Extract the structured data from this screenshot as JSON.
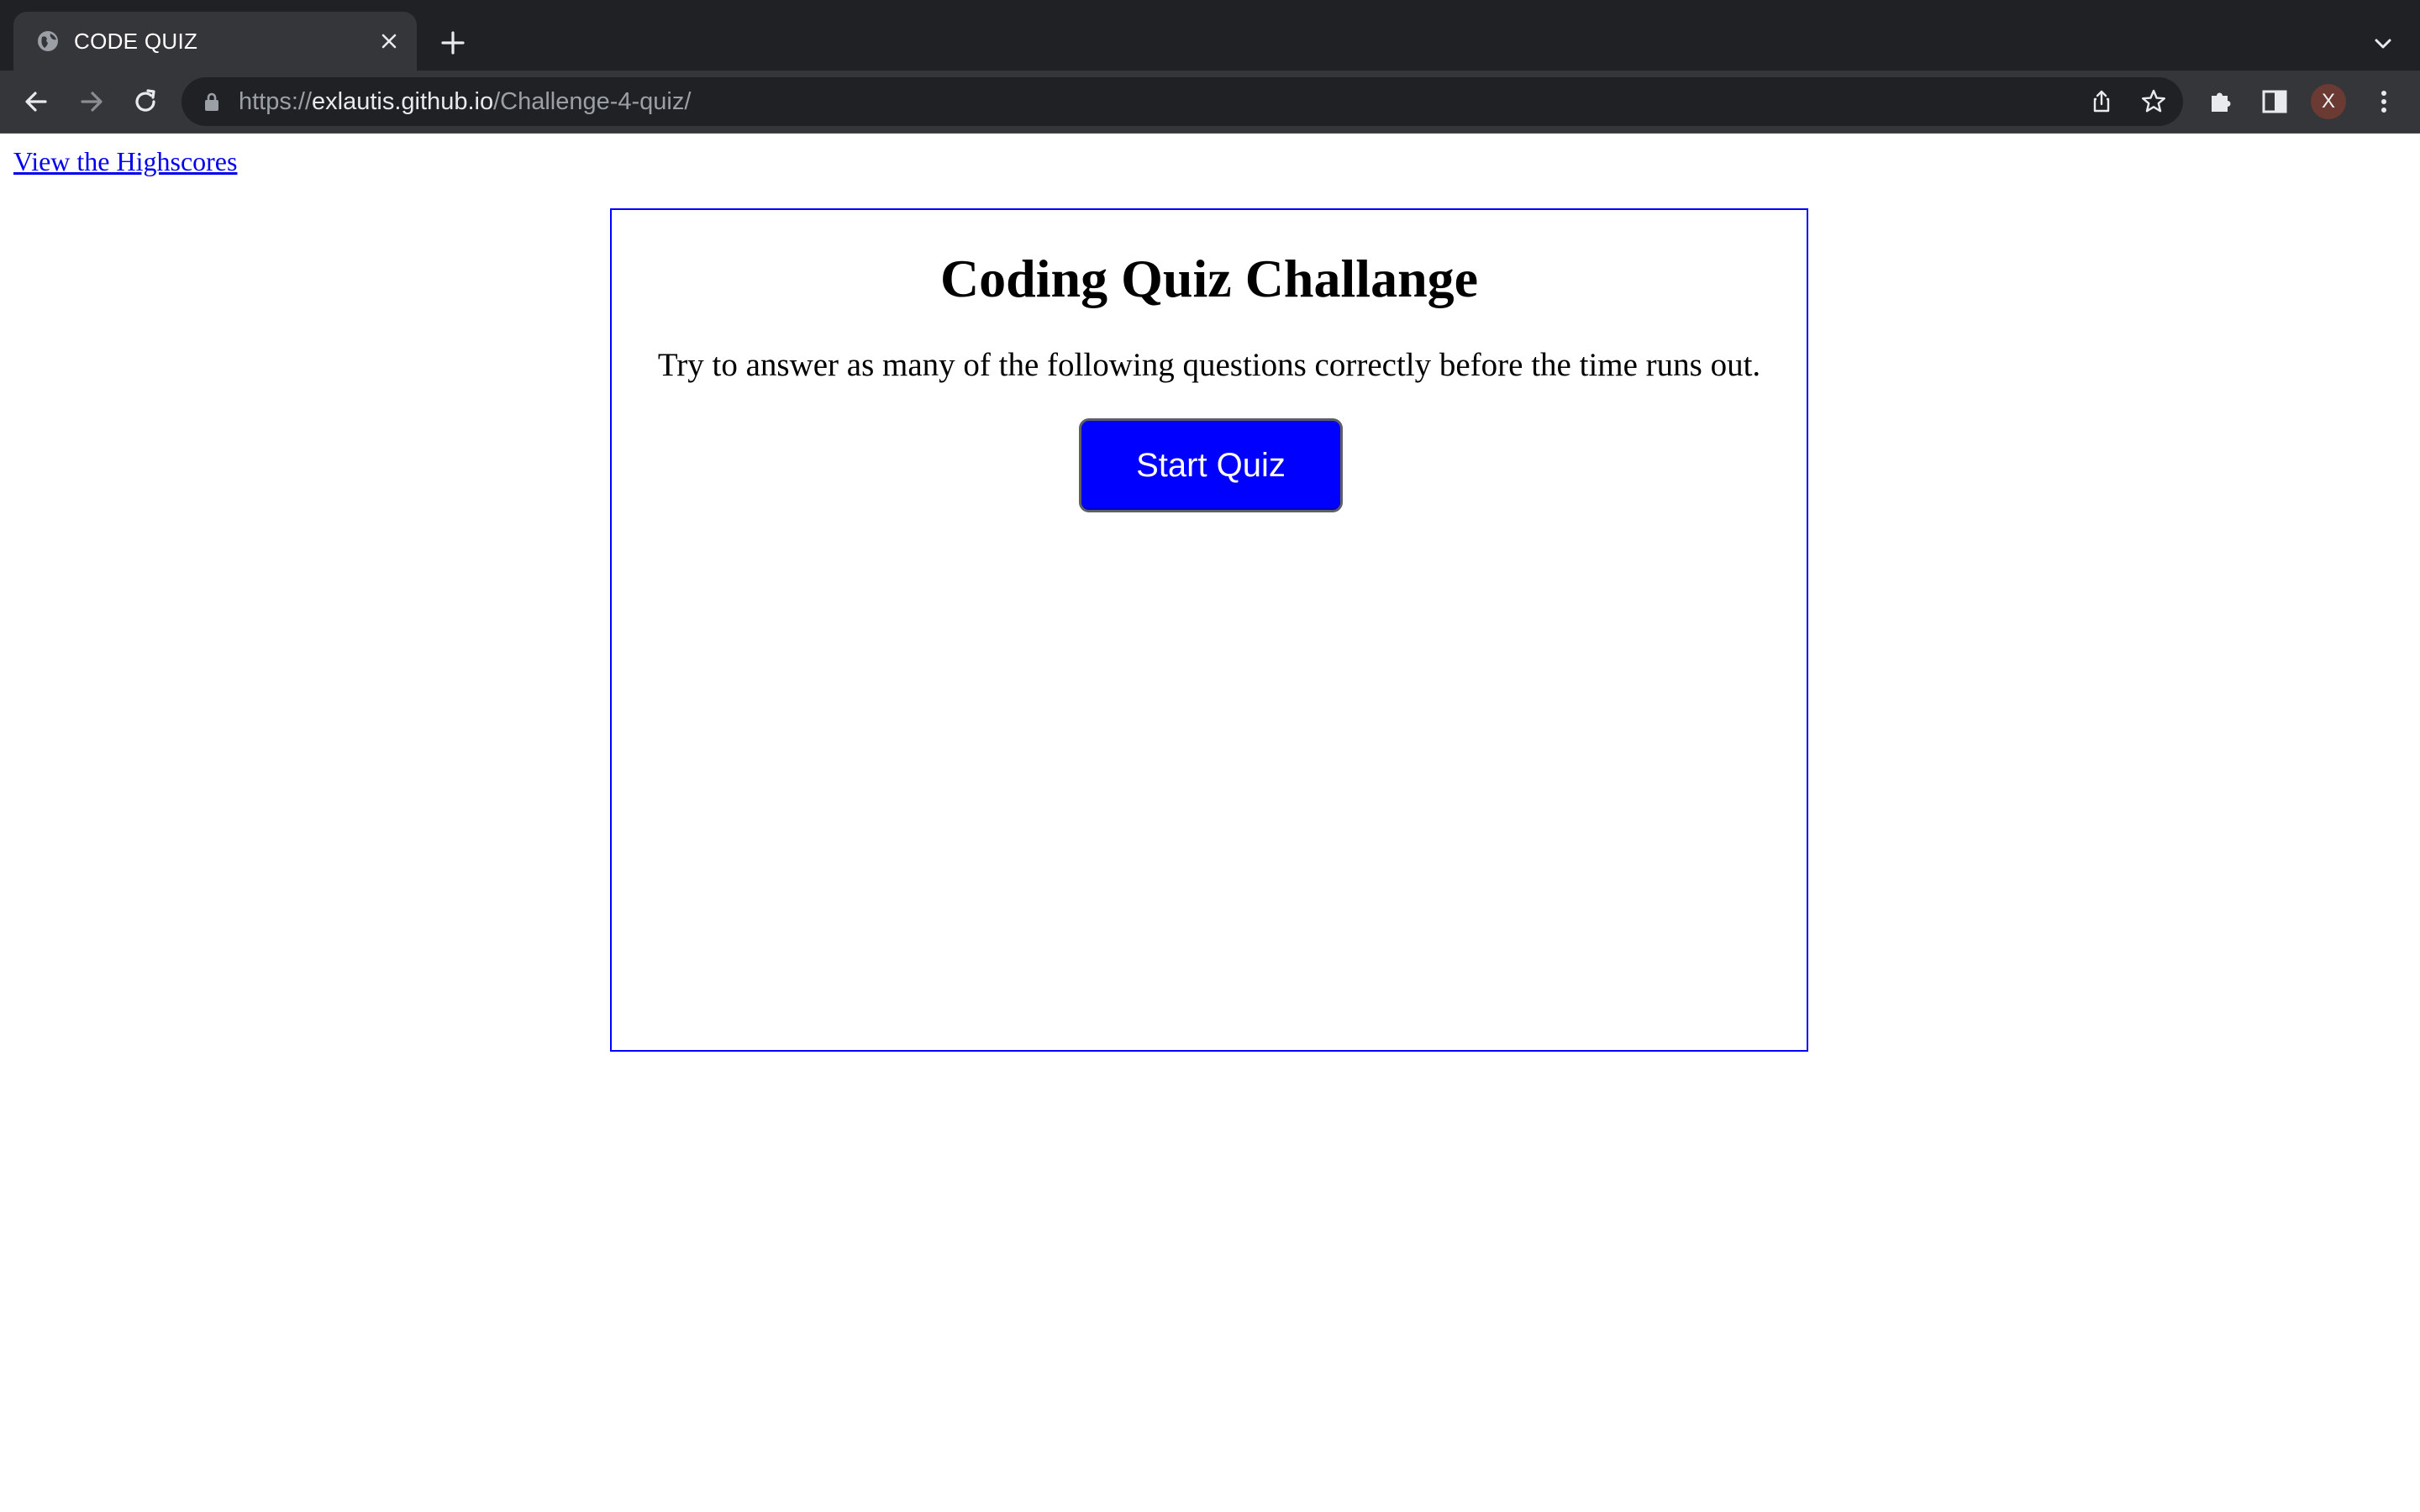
{
  "browser": {
    "tab_title": "CODE QUIZ",
    "url_scheme": "https://",
    "url_host": "exlautis.github.io",
    "url_path": "/Challenge-4-quiz/",
    "profile_initial": "X",
    "icons": {
      "favicon": "globe-icon",
      "tab_close": "close-icon",
      "new_tab": "plus-icon",
      "tab_search": "chevron-down-icon",
      "back": "arrow-left-icon",
      "forward": "arrow-right-icon",
      "reload": "reload-icon",
      "lock": "lock-icon",
      "share": "share-icon",
      "bookmark": "star-icon",
      "extensions": "puzzle-icon",
      "side_panel": "side-panel-icon",
      "menu": "kebab-menu-icon"
    },
    "colors": {
      "tabstrip": "#202124",
      "toolbar": "#35363a",
      "omnibox": "#202124",
      "avatar": "#6a3a33"
    }
  },
  "page": {
    "highscores_link": "View the Highscores",
    "title": "Coding Quiz Challange",
    "description": "Try to answer as many of the following questions correctly before the time runs out.",
    "start_button": "Start Quiz",
    "colors": {
      "link": "#0000ee",
      "box_border": "#0000ff",
      "button_bg": "#0000ff",
      "button_text": "#ffffff"
    }
  }
}
